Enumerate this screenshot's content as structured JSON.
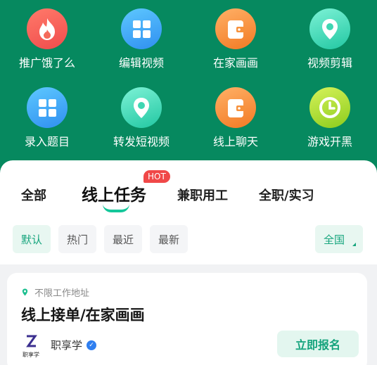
{
  "categories": [
    {
      "label": "推广饿了么",
      "icon": "flame-icon"
    },
    {
      "label": "编辑视频",
      "icon": "grid-icon"
    },
    {
      "label": "在家画画",
      "icon": "wallet-icon"
    },
    {
      "label": "视频剪辑",
      "icon": "map-pin-icon"
    },
    {
      "label": "录入题目",
      "icon": "grid-icon"
    },
    {
      "label": "转发短视频",
      "icon": "map-pin-icon"
    },
    {
      "label": "线上聊天",
      "icon": "wallet-icon"
    },
    {
      "label": "游戏开黑",
      "icon": "clock-icon"
    }
  ],
  "tabs": [
    {
      "label": "全部"
    },
    {
      "label": "线上任务",
      "badge": "HOT"
    },
    {
      "label": "兼职用工"
    },
    {
      "label": "全职/实习"
    }
  ],
  "filters": [
    "默认",
    "热门",
    "最近",
    "最新"
  ],
  "region": "全国",
  "job": {
    "location": "不限工作地址",
    "title": "线上接单/在家画画",
    "company": "职享学",
    "logo_text": "职享学",
    "apply_label": "立即报名"
  },
  "colors": {
    "brand_green": "#06895f",
    "accent_green": "#14c79a",
    "hot_red": "#f04848"
  }
}
